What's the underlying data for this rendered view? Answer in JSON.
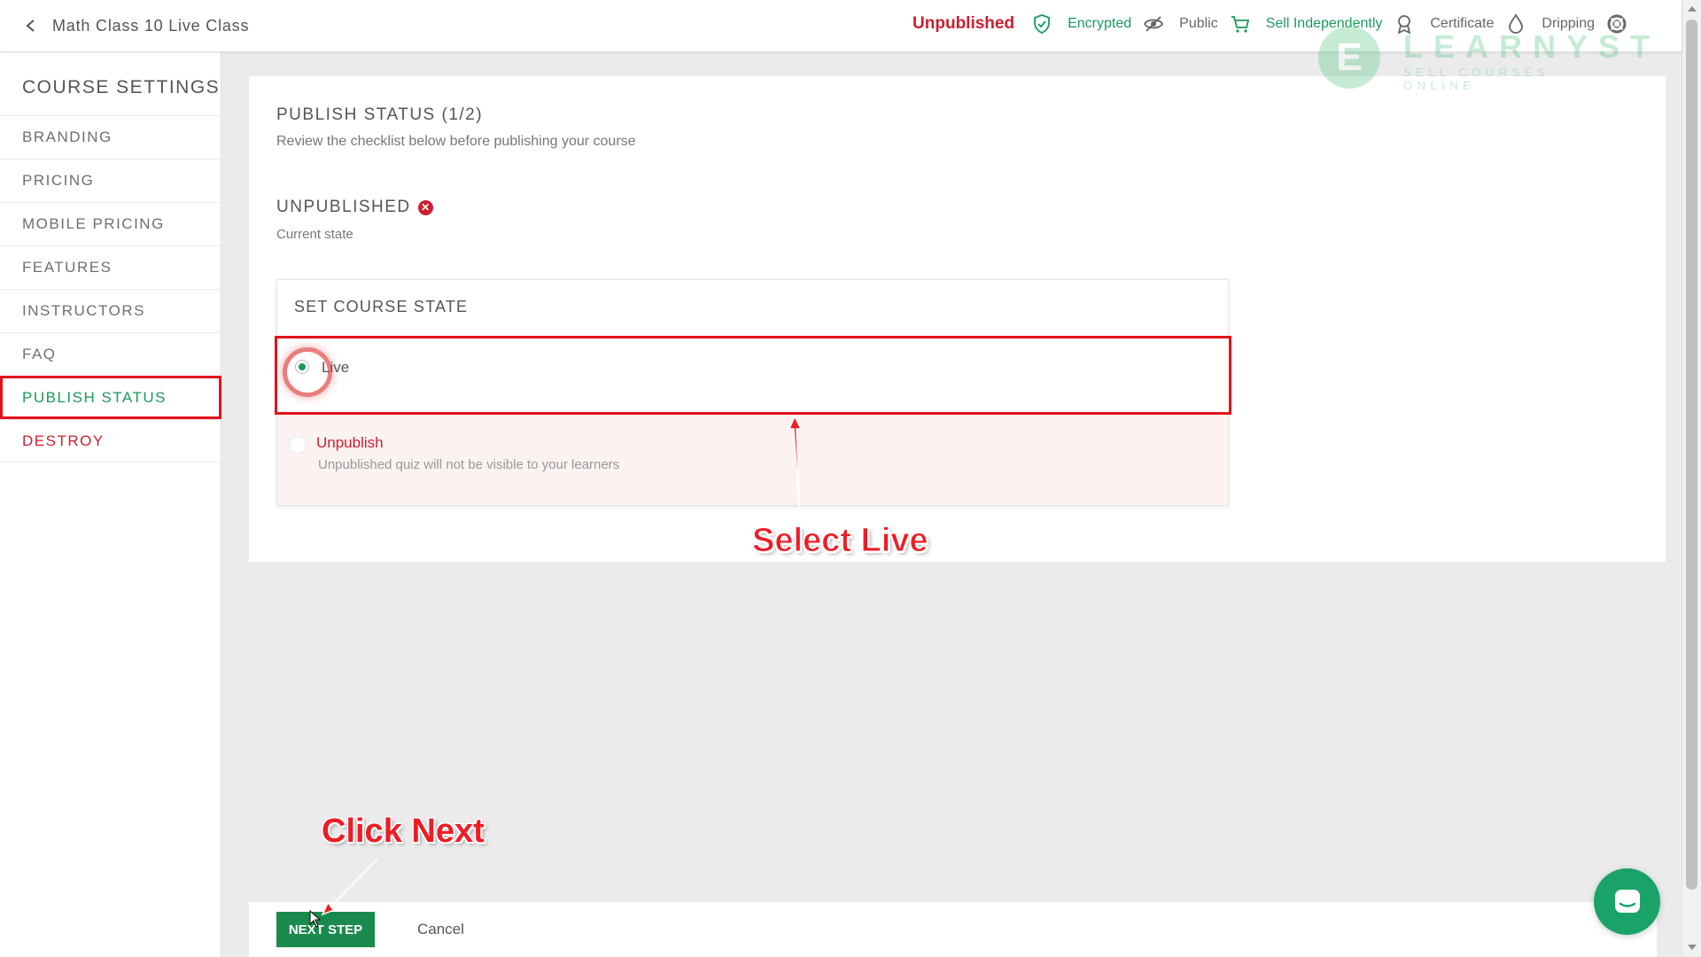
{
  "header": {
    "course_title": "Math Class 10 Live Class",
    "status": "Unpublished",
    "badges": [
      {
        "icon": "shield-check-icon",
        "label": "Encrypted",
        "color": "#1a9a5b"
      },
      {
        "icon": "eye-slash-icon",
        "label": "Public",
        "color": "#666666"
      },
      {
        "icon": "cart-icon",
        "label": "Sell Independently",
        "color": "#1a9a5b"
      },
      {
        "icon": "award-icon",
        "label": "Certificate",
        "color": "#666666"
      },
      {
        "icon": "droplet-icon",
        "label": "Dripping",
        "color": "#666666"
      },
      {
        "icon": "lifebuoy-icon",
        "label": "",
        "color": "#666666"
      }
    ]
  },
  "watermark": {
    "letter": "E",
    "name": "LEARNYST",
    "tagline": "SELL COURSES ONLINE"
  },
  "sidebar": {
    "title": "COURSE SETTINGS",
    "items": [
      {
        "label": "BRANDING"
      },
      {
        "label": "PRICING"
      },
      {
        "label": "MOBILE PRICING"
      },
      {
        "label": "FEATURES"
      },
      {
        "label": "INSTRUCTORS"
      },
      {
        "label": "FAQ"
      },
      {
        "label": "PUBLISH STATUS"
      },
      {
        "label": "DESTROY"
      }
    ],
    "active_item": "PUBLISH STATUS"
  },
  "main": {
    "title": "PUBLISH STATUS (1/2)",
    "subtitle": "Review the checklist below before publishing your course",
    "current_state": {
      "label": "UNPUBLISHED",
      "caption": "Current state"
    },
    "course_state": {
      "title": "SET COURSE STATE",
      "options": [
        {
          "label": "Live",
          "selected": true,
          "description": ""
        },
        {
          "label": "Unpublish",
          "selected": false,
          "description": "Unpublished quiz will not be visible to your learners"
        }
      ]
    }
  },
  "annotations": {
    "select_live": "Select Live",
    "click_next": "Click Next"
  },
  "footer": {
    "next_label": "NEXT STEP",
    "cancel_label": "Cancel"
  },
  "colors": {
    "accent_green": "#1a9a5b",
    "danger_red": "#cc1f2f",
    "annotation_red": "#ee1c25"
  }
}
